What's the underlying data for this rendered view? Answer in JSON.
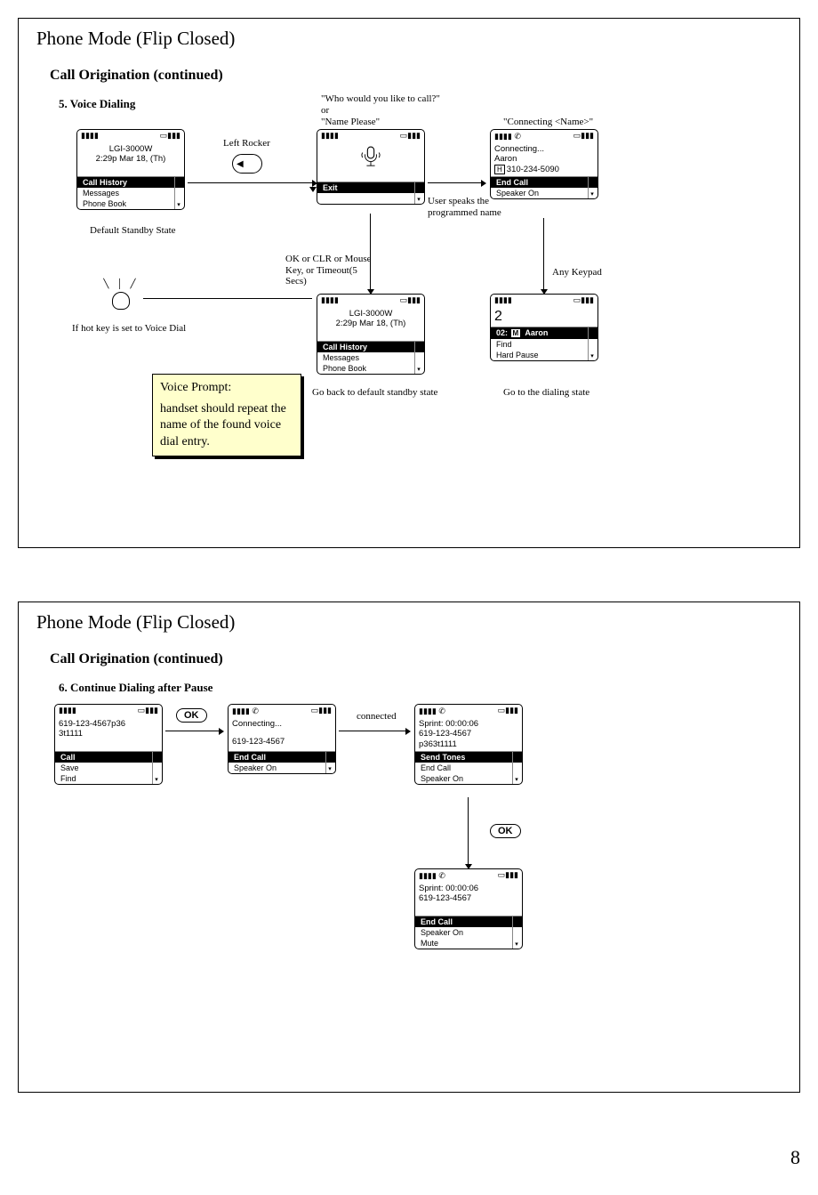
{
  "page_number": "8",
  "panel1": {
    "title": "Phone Mode (Flip Closed)",
    "section": "Call Origination (continued)",
    "step": "5. Voice Dialing",
    "standby": {
      "line1": "LGI-3000W",
      "line2": "2:29p Mar 18, (Th)",
      "menu_sel": "Call History",
      "menu2": "Messages",
      "menu3": "Phone Book",
      "caption": "Default Standby State"
    },
    "left_rocker_label": "Left Rocker",
    "prompt_lines": {
      "l1": "\"Who would you like to call?\"",
      "l2": "or",
      "l3": "\"Name Please\""
    },
    "voice_screen": {
      "menu_sel": "Exit"
    },
    "user_speaks": "User speaks the programmed name",
    "connecting_label": "\"Connecting <Name>\"",
    "connecting_screen": {
      "line1": "Connecting...",
      "line2": "Aaron",
      "tag": "H",
      "number": "310-234-5090",
      "menu_sel": "End Call",
      "menu2": "Speaker On"
    },
    "hotkey_label": "If hot key is set to Voice Dial",
    "back_condition": "OK or CLR or Mouse Key, or Timeout(5 Secs)",
    "standby2_caption": "Go back to default standby state",
    "any_keypad": "Any Keypad",
    "dial_screen": {
      "digit": "2",
      "sel_prefix": "02:",
      "sel_tag": "M",
      "sel_name": "Aaron",
      "menu2": "Find",
      "menu3": "Hard Pause",
      "caption": "Go to the dialing state"
    },
    "note": {
      "title": "Voice Prompt:",
      "body": "handset should repeat the name of the found voice dial entry."
    }
  },
  "panel2": {
    "title": "Phone Mode (Flip Closed)",
    "section": "Call Origination (continued)",
    "step": "6. Continue Dialing after Pause",
    "entry": {
      "line1": "619-123-4567p36",
      "line2": "3t1111",
      "menu_sel": "Call",
      "menu2": "Save",
      "menu3": "Find"
    },
    "ok_label": "OK",
    "connecting": {
      "line1": "Connecting...",
      "line2": "619-123-4567",
      "menu_sel": "End Call",
      "menu2": "Speaker On"
    },
    "connected_label": "connected",
    "incall1": {
      "line1": "Sprint: 00:00:06",
      "line2": "619-123-4567",
      "line3": "p363t1111",
      "menu_sel": "Send Tones",
      "menu2": "End Call",
      "menu3": "Speaker On"
    },
    "incall2": {
      "line1": "Sprint: 00:00:06",
      "line2": "619-123-4567",
      "menu_sel": "End Call",
      "menu2": "Speaker On",
      "menu3": "Mute"
    }
  }
}
